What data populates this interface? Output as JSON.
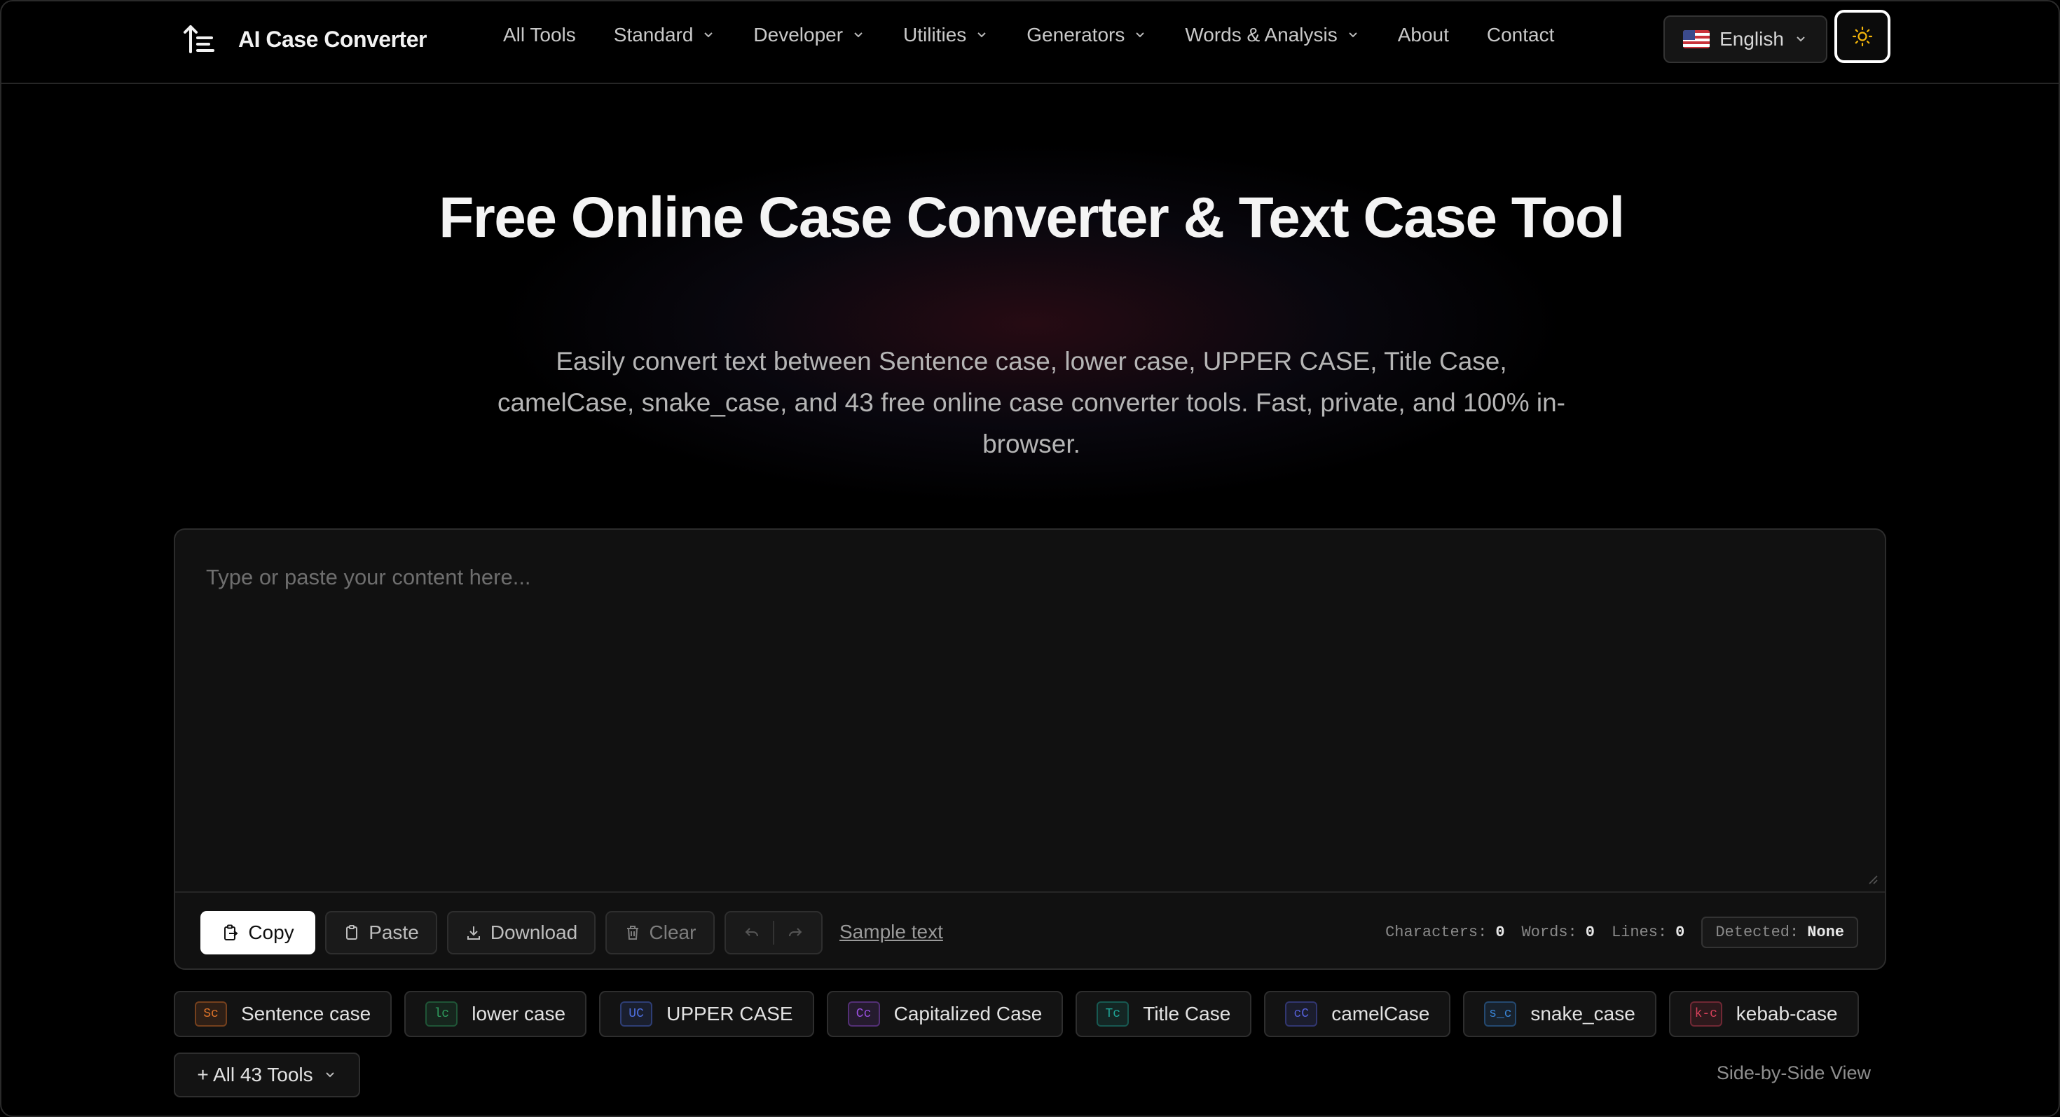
{
  "app": {
    "name": "AI Case Converter"
  },
  "nav": [
    {
      "label": "All Tools",
      "dropdown": false
    },
    {
      "label": "Standard",
      "dropdown": true
    },
    {
      "label": "Developer",
      "dropdown": true
    },
    {
      "label": "Utilities",
      "dropdown": true
    },
    {
      "label": "Generators",
      "dropdown": true
    },
    {
      "label": "Words & Analysis",
      "dropdown": true
    },
    {
      "label": "About",
      "dropdown": false
    },
    {
      "label": "Contact",
      "dropdown": false
    }
  ],
  "language": {
    "selected": "English",
    "flag_icon": "us-flag-icon"
  },
  "theme_toggle": {
    "icon": "sun-icon",
    "color": "#f5b60a"
  },
  "hero": {
    "title": "Free Online Case Converter & Text Case Tool",
    "subtitle": "Easily convert text between Sentence case, lower case, UPPER CASE, Title Case, camelCase, snake_case, and 43 free online case converter tools. Fast, private, and 100% in-browser."
  },
  "editor": {
    "placeholder": "Type or paste your content here...",
    "value": "",
    "copy_label": "Copy",
    "paste_label": "Paste",
    "download_label": "Download",
    "clear_label": "Clear",
    "sample_text_label": "Sample text"
  },
  "stats": {
    "characters_label": "Characters:",
    "characters": "0",
    "words_label": "Words:",
    "words": "0",
    "lines_label": "Lines:",
    "lines": "0",
    "detected_label": "Detected:",
    "detected": "None"
  },
  "chips": [
    {
      "badge": "Sc",
      "label": "Sentence case",
      "color": "#e0742a"
    },
    {
      "badge": "lc",
      "label": "lower case",
      "color": "#2f9e5e"
    },
    {
      "badge": "UC",
      "label": "UPPER CASE",
      "color": "#4d6fe0"
    },
    {
      "badge": "Cc",
      "label": "Capitalized Case",
      "color": "#9a4fe0"
    },
    {
      "badge": "Tc",
      "label": "Title Case",
      "color": "#1fa597"
    },
    {
      "badge": "cC",
      "label": "camelCase",
      "color": "#5560d8"
    },
    {
      "badge": "s_c",
      "label": "snake_case",
      "color": "#3a86d8"
    },
    {
      "badge": "k-c",
      "label": "kebab-case",
      "color": "#d6405a"
    }
  ],
  "all_tools_label": "+ All 43 Tools",
  "side_by_side_label": "Side-by-Side View"
}
